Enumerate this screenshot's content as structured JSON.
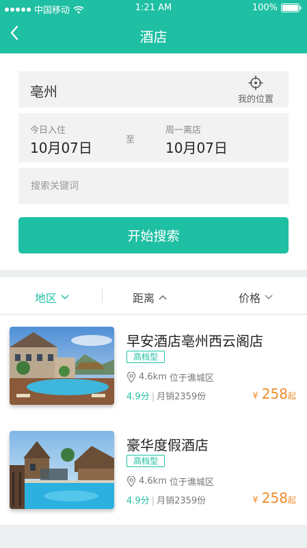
{
  "status_bar": {
    "carrier": "中国移动",
    "time": "1:21 AM",
    "battery": "100%"
  },
  "header": {
    "title": "酒店"
  },
  "search": {
    "city": "亳州",
    "locate_label": "我的位置",
    "checkin_label": "今日入住",
    "checkin_date": "10月07日",
    "separator": "至",
    "checkout_label": "周一离店",
    "checkout_date": "10月07日",
    "keyword_placeholder": "搜索关键词",
    "button_label": "开始搜索"
  },
  "filters": {
    "area": "地区",
    "distance": "距离",
    "price": "价格"
  },
  "hotels": [
    {
      "name": "早安酒店亳州西云阁店",
      "tag": "高档型",
      "distance": "4.6km",
      "location": "位于谯城区",
      "rating": "4.9分",
      "sales": "月销2359份",
      "price_symbol": "¥",
      "price": "258",
      "price_suffix": "起"
    },
    {
      "name": "豪华度假酒店",
      "tag": "高档型",
      "distance": "4.6km",
      "location": "位于谯城区",
      "rating": "4.9分",
      "sales": "月销2359份",
      "price_symbol": "¥",
      "price": "258",
      "price_suffix": "起"
    }
  ],
  "colors": {
    "brand": "#1fbfa3",
    "price": "#f08a2b"
  },
  "icons": [
    "back-icon",
    "wifi-icon",
    "battery-icon",
    "locate-icon",
    "chevron-down-icon",
    "chevron-up-icon",
    "location-pin-icon"
  ]
}
